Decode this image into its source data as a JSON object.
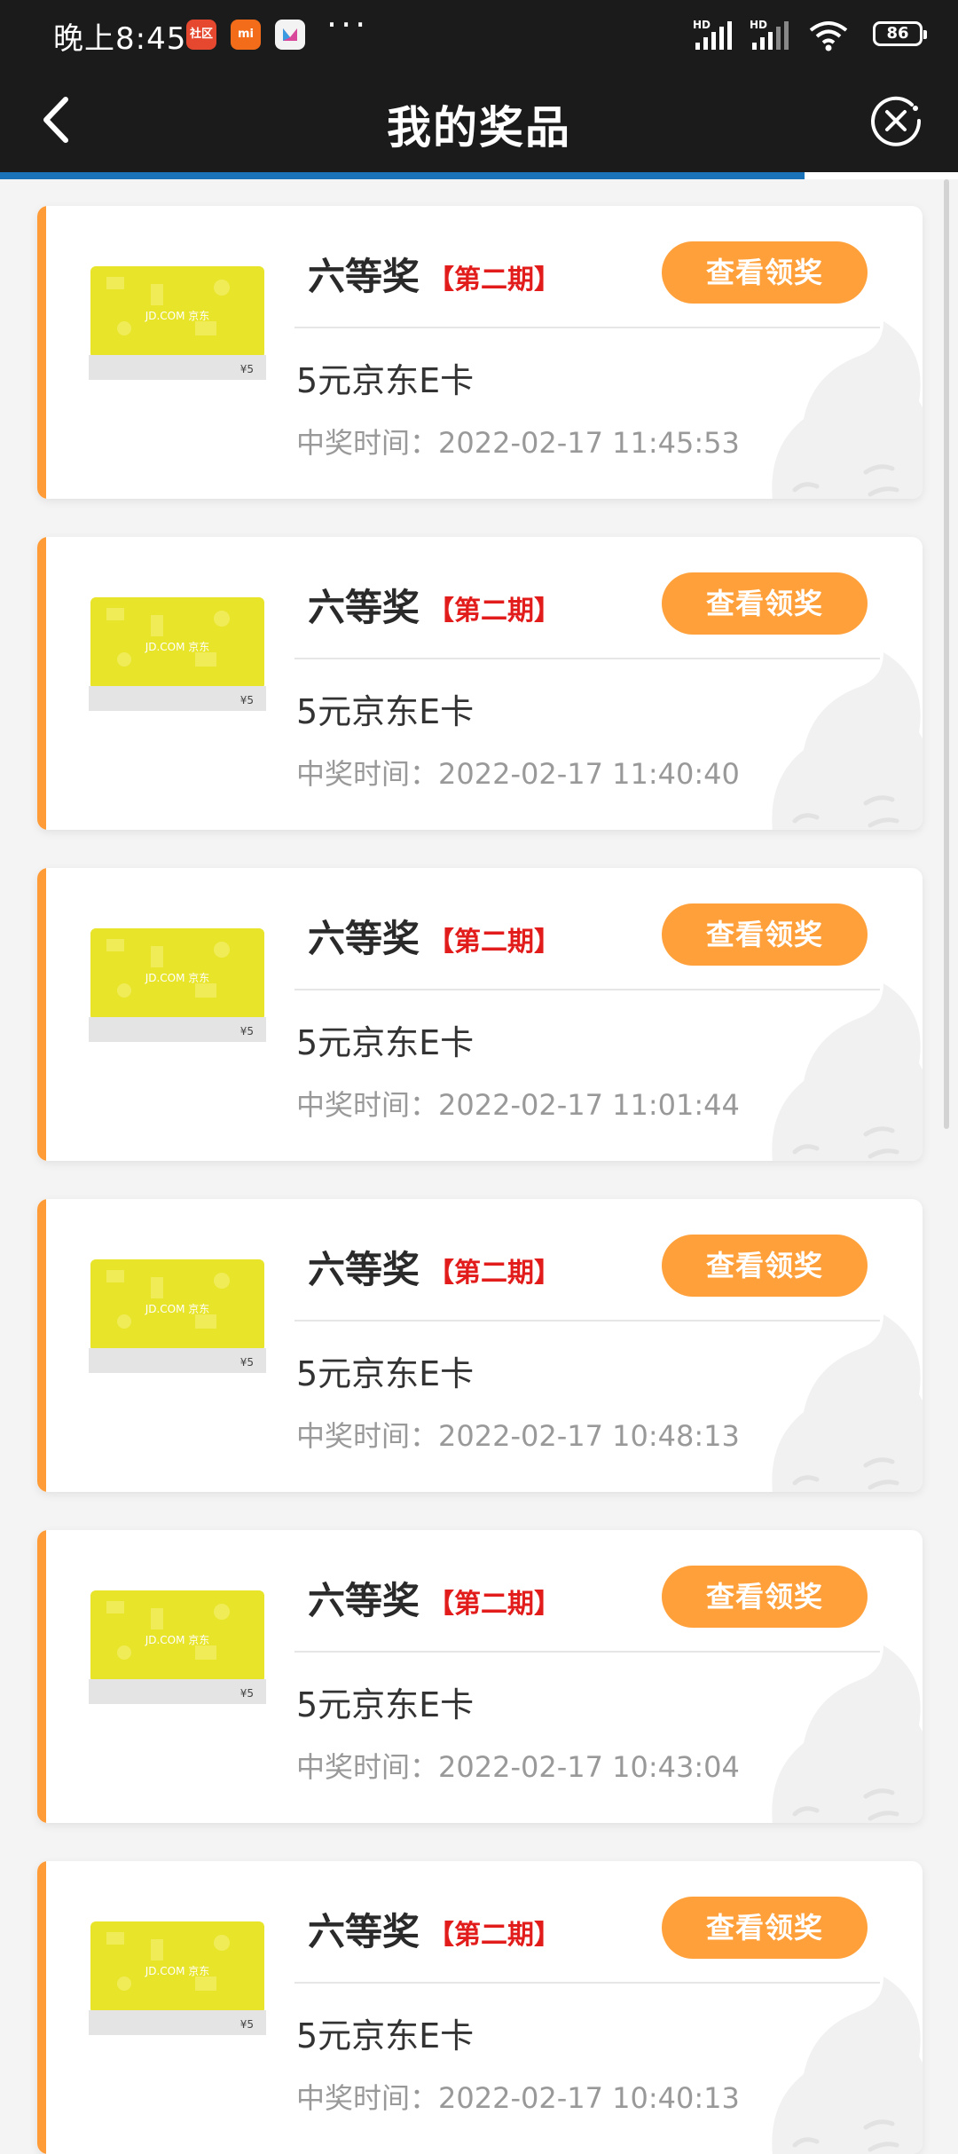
{
  "status_bar": {
    "time": "晚上8:45",
    "app_icons": [
      {
        "label": "社区",
        "color": "#e5482e"
      },
      {
        "label": "mi",
        "color": "#f26c1a"
      },
      {
        "label": "",
        "color": "#f3f3f3"
      }
    ],
    "overflow": "···",
    "network_labels": [
      "HD",
      "HD"
    ],
    "battery": "86"
  },
  "header": {
    "title": "我的奖品",
    "back_icon": "chevron-left-icon",
    "close_icon": "close-circle-icon"
  },
  "load_progress": 0.84,
  "colors": {
    "accent": "#ff9c38",
    "button": "#ffa03a",
    "period_red": "#e21b1b",
    "progress_blue": "#1a73b8"
  },
  "prizes": [
    {
      "name": "六等奖",
      "period": "【第二期】",
      "button": "查看领奖",
      "desc": "5元京东E卡",
      "time": "中奖时间：2022-02-17 11:45:53",
      "card_brand": "JD.COM 京东",
      "card_price": "¥5"
    },
    {
      "name": "六等奖",
      "period": "【第二期】",
      "button": "查看领奖",
      "desc": "5元京东E卡",
      "time": "中奖时间：2022-02-17 11:40:40",
      "card_brand": "JD.COM 京东",
      "card_price": "¥5"
    },
    {
      "name": "六等奖",
      "period": "【第二期】",
      "button": "查看领奖",
      "desc": "5元京东E卡",
      "time": "中奖时间：2022-02-17 11:01:44",
      "card_brand": "JD.COM 京东",
      "card_price": "¥5"
    },
    {
      "name": "六等奖",
      "period": "【第二期】",
      "button": "查看领奖",
      "desc": "5元京东E卡",
      "time": "中奖时间：2022-02-17 10:48:13",
      "card_brand": "JD.COM 京东",
      "card_price": "¥5"
    },
    {
      "name": "六等奖",
      "period": "【第二期】",
      "button": "查看领奖",
      "desc": "5元京东E卡",
      "time": "中奖时间：2022-02-17 10:43:04",
      "card_brand": "JD.COM 京东",
      "card_price": "¥5"
    },
    {
      "name": "六等奖",
      "period": "【第二期】",
      "button": "查看领奖",
      "desc": "5元京东E卡",
      "time": "中奖时间：2022-02-17 10:40:13",
      "card_brand": "JD.COM 京东",
      "card_price": "¥5"
    }
  ]
}
